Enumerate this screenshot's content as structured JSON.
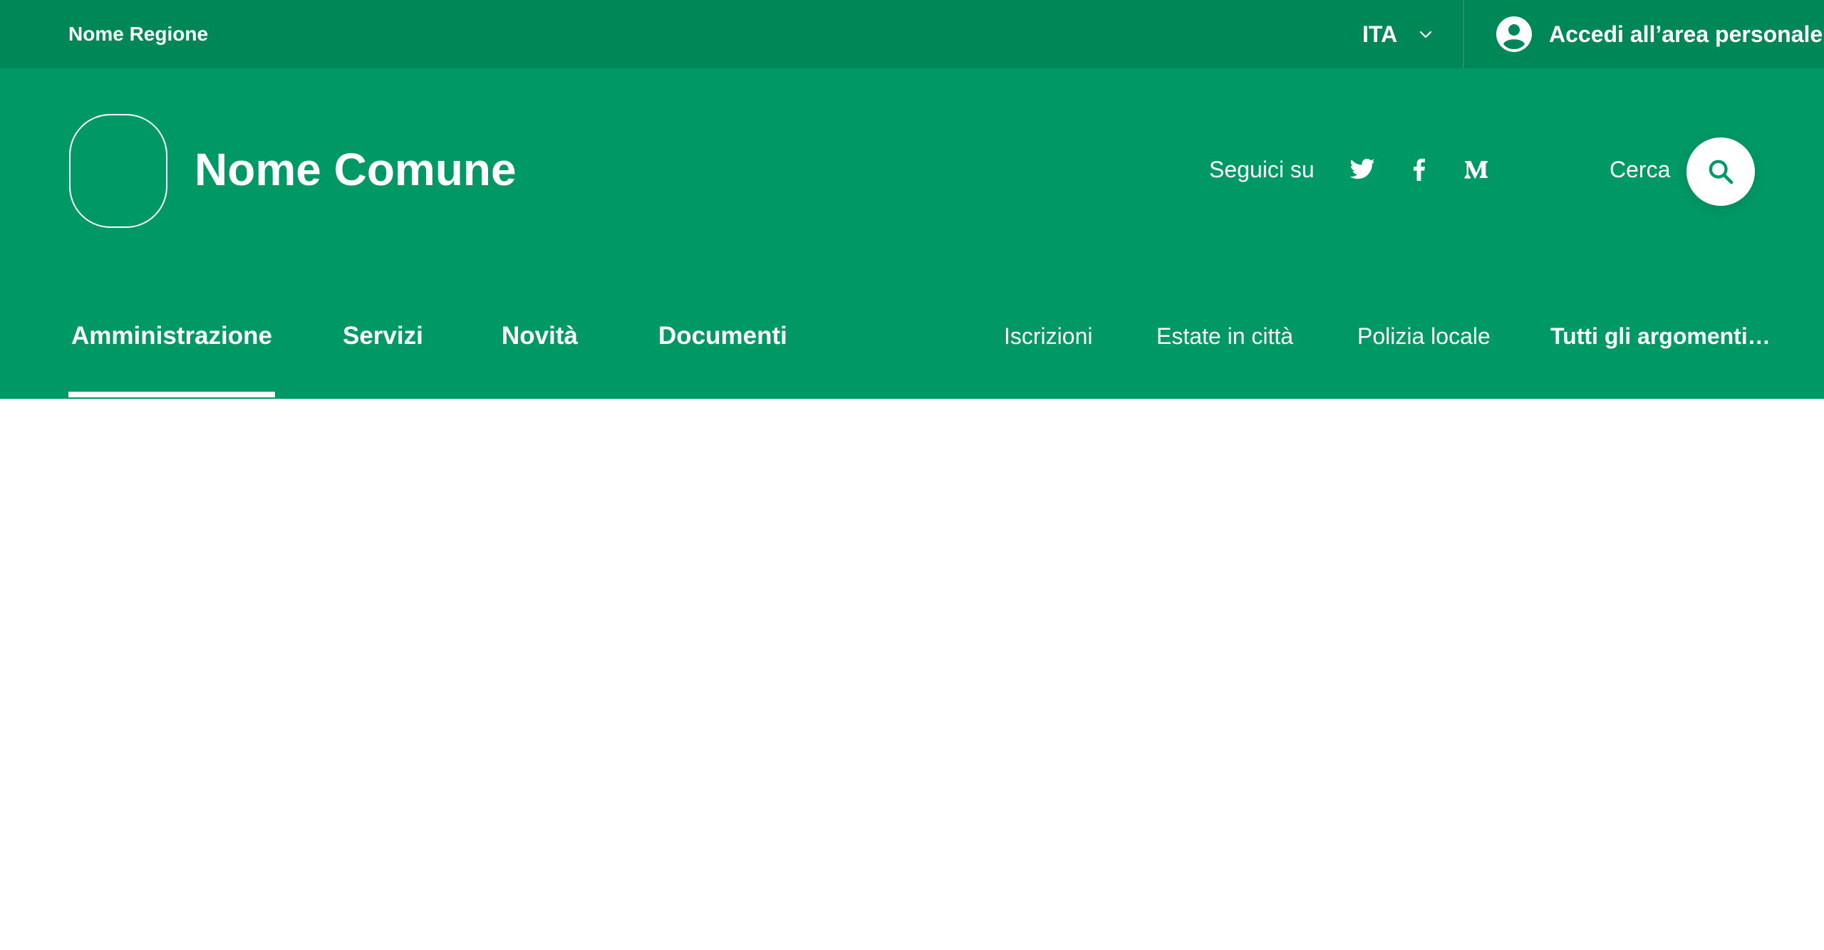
{
  "slim_header": {
    "region": "Nome Regione",
    "language": "ITA",
    "login_label": "Accedi all’area personale"
  },
  "center_header": {
    "brand_name": "Nome Comune",
    "follow_label": "Seguici su",
    "social_icons": [
      "twitter-icon",
      "facebook-icon",
      "medium-icon"
    ],
    "search_label": "Cerca"
  },
  "navbar": {
    "main_items": [
      {
        "label": "Amministrazione",
        "active": true
      },
      {
        "label": "Servizi"
      },
      {
        "label": "Novità"
      },
      {
        "label": "Documenti"
      }
    ],
    "secondary_items": [
      {
        "label": "Iscrizioni"
      },
      {
        "label": "Estate in città"
      },
      {
        "label": "Polizia locale"
      },
      {
        "label": "Tutti gli argomenti…"
      }
    ]
  },
  "colors": {
    "slim_bg": "#008758",
    "header_bg": "#009966",
    "accent": "#009966",
    "text": "#ffffff"
  }
}
